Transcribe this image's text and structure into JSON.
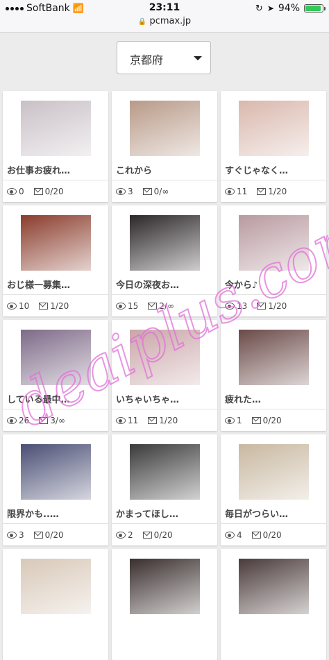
{
  "status_bar": {
    "carrier": "SoftBank",
    "time": "23:11",
    "url": "pcmax.jp",
    "battery": "94%"
  },
  "region_select": {
    "value": "京都府"
  },
  "cards": [
    {
      "title": "お仕事お疲れ…",
      "views": "0",
      "messages": "0/20",
      "photo_color": "#c9c0c6"
    },
    {
      "title": "これから",
      "views": "3",
      "messages": "0/∞",
      "photo_color": "#b89a88"
    },
    {
      "title": "すぐじゃなく…",
      "views": "11",
      "messages": "1/20",
      "photo_color": "#d9b8ad"
    },
    {
      "title": "おじ様一募集…",
      "views": "10",
      "messages": "1/20",
      "photo_color": "#8a3c2c"
    },
    {
      "title": "今日の深夜お…",
      "views": "15",
      "messages": "2/∞",
      "photo_color": "#2b2628"
    },
    {
      "title": "今から♪",
      "views": "13",
      "messages": "1/20",
      "photo_color": "#b89aa0"
    },
    {
      "title": "している最中…",
      "views": "26",
      "messages": "3/∞",
      "photo_color": "#7e6a88"
    },
    {
      "title": "いちゃいちゃ…",
      "views": "11",
      "messages": "1/20",
      "photo_color": "#caa6a8"
    },
    {
      "title": "疲れた…",
      "views": "1",
      "messages": "0/20",
      "photo_color": "#6a4a48"
    },
    {
      "title": "限界かも..…",
      "views": "3",
      "messages": "0/20",
      "photo_color": "#4a4e74"
    },
    {
      "title": "かまってほし…",
      "views": "2",
      "messages": "0/20",
      "photo_color": "#3a3a3a"
    },
    {
      "title": "毎日がつらい…",
      "views": "4",
      "messages": "0/20",
      "photo_color": "#c8b8a0"
    },
    {
      "title": "",
      "views": "",
      "messages": "",
      "photo_color": "#d8c8b8"
    },
    {
      "title": "",
      "views": "",
      "messages": "",
      "photo_color": "#3a2e2e"
    },
    {
      "title": "",
      "views": "",
      "messages": "",
      "photo_color": "#4a3a3a"
    }
  ],
  "colors": {
    "background": "#ececec",
    "card": "#ffffff",
    "watermark": "#e070d8",
    "battery": "#34c759"
  }
}
